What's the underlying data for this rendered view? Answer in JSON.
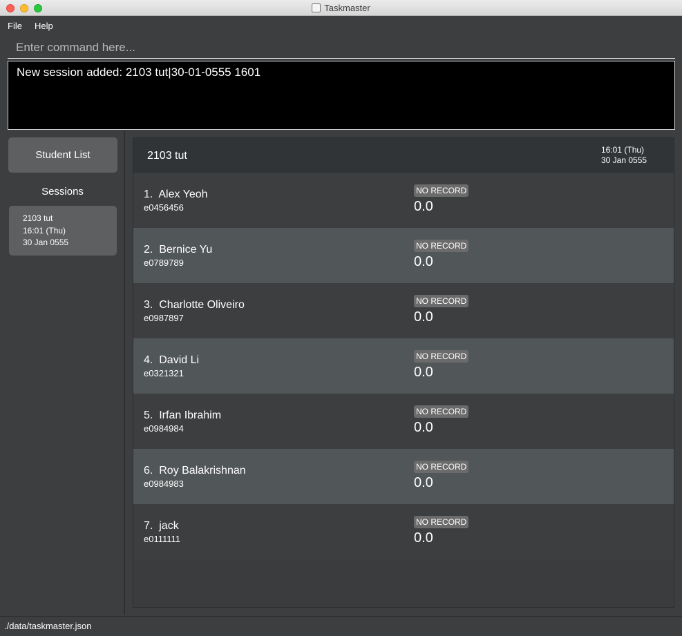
{
  "window": {
    "title": "Taskmaster"
  },
  "menu": {
    "file": "File",
    "help": "Help"
  },
  "command": {
    "placeholder": "Enter command here...",
    "value": ""
  },
  "result": {
    "text": "New session added: 2103 tut|30-01-0555 1601"
  },
  "sidebar": {
    "student_list_label": "Student List",
    "sessions_label": "Sessions",
    "sessions": [
      {
        "name": "2103 tut",
        "time": "16:01 (Thu)",
        "date": "30 Jan 0555"
      }
    ]
  },
  "main": {
    "session_title": "2103 tut",
    "session_time": "16:01 (Thu)",
    "session_date": "30 Jan 0555",
    "students": [
      {
        "index": "1.",
        "name": "Alex Yeoh",
        "id": "e0456456",
        "status": "NO RECORD",
        "score": "0.0"
      },
      {
        "index": "2.",
        "name": "Bernice Yu",
        "id": "e0789789",
        "status": "NO RECORD",
        "score": "0.0"
      },
      {
        "index": "3.",
        "name": "Charlotte Oliveiro",
        "id": "e0987897",
        "status": "NO RECORD",
        "score": "0.0"
      },
      {
        "index": "4.",
        "name": "David Li",
        "id": "e0321321",
        "status": "NO RECORD",
        "score": "0.0"
      },
      {
        "index": "5.",
        "name": "Irfan Ibrahim",
        "id": "e0984984",
        "status": "NO RECORD",
        "score": "0.0"
      },
      {
        "index": "6.",
        "name": "Roy Balakrishnan",
        "id": "e0984983",
        "status": "NO RECORD",
        "score": "0.0"
      },
      {
        "index": "7.",
        "name": "jack",
        "id": "e0111111",
        "status": "NO RECORD",
        "score": "0.0"
      }
    ]
  },
  "status_bar": {
    "path": "./data/taskmaster.json"
  },
  "colors": {
    "row_odd": "#3c3e40",
    "row_even": "#515658",
    "badge": "#6b6b6b",
    "result_bg": "#000000"
  }
}
